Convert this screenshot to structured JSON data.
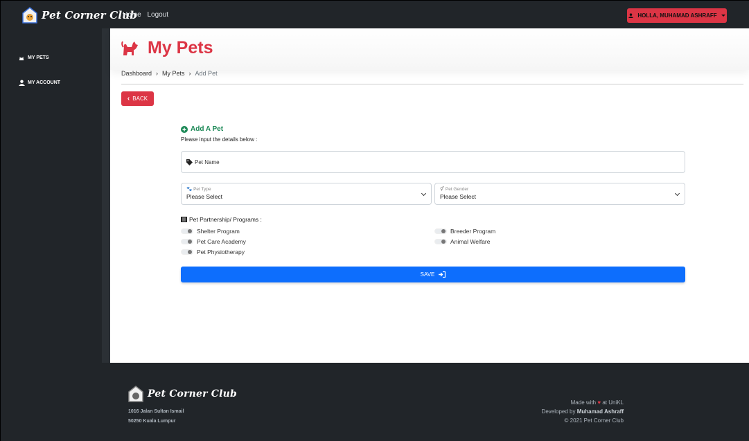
{
  "header": {
    "brand": "Pet Corner Club",
    "nav": [
      "Home",
      "Logout"
    ],
    "user_label": "HOLLA, MUHAMAD ASHRAFF"
  },
  "sidebar": {
    "items": [
      {
        "label": "MY PETS",
        "icon": "cat-icon"
      },
      {
        "label": "MY ACCOUNT",
        "icon": "user-icon"
      }
    ]
  },
  "page": {
    "title": "My Pets",
    "breadcrumb": [
      "Dashboard",
      "My Pets",
      "Add Pet"
    ],
    "back_label": "BACK"
  },
  "form": {
    "title": "Add A Pet",
    "subtitle": "Please input the details below :",
    "pet_name_placeholder": "Pet Name",
    "pet_type": {
      "label": "Pet Type",
      "value": "Please Select"
    },
    "pet_gender": {
      "label": "Pet Gender",
      "value": "Please Select"
    },
    "programs_label": "Pet Partnership/ Programs :",
    "programs": [
      "Shelter Program",
      "Breeder Program",
      "Pet Care Academy",
      "Animal Welfare",
      "Pet Physiotherapy"
    ],
    "save_label": "SAVE"
  },
  "footer": {
    "brand": "Pet Corner Club",
    "address_1": "1016 Jalan Sultan Ismail",
    "address_2": "50250 Kuala Lumpur",
    "made_with_pre": "Made with",
    "made_with_post": "at UniKL",
    "developed_by": "Developed by",
    "developer": "Muhamad Ashraff",
    "copyright": "© 2021 Pet Corner Club"
  },
  "colors": {
    "accent": "#dc3545",
    "primary": "#0d6efd",
    "success": "#198754",
    "dark": "#212529"
  }
}
